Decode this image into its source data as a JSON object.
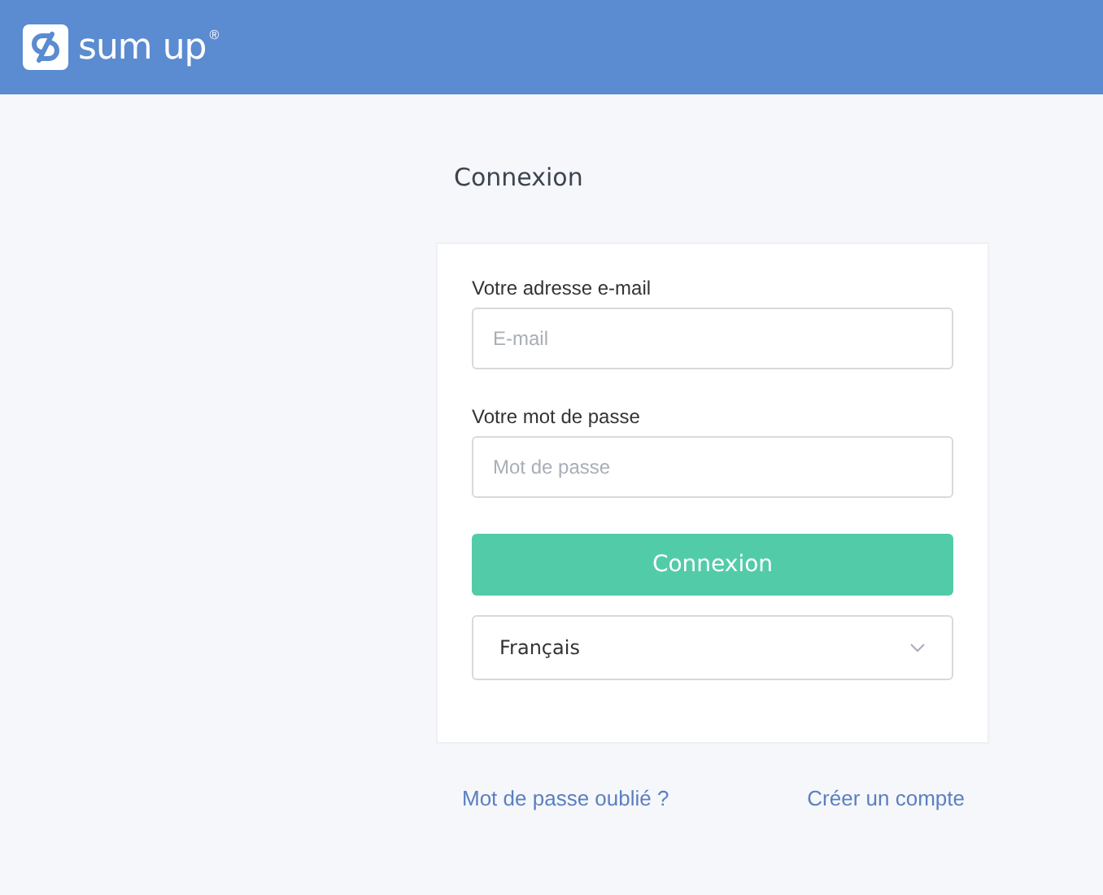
{
  "header": {
    "logo_text": "sum up",
    "logo_mark": "®"
  },
  "title": "Connexion",
  "form": {
    "fields": [
      {
        "label": "Votre adresse e-mail",
        "placeholder": "E-mail"
      },
      {
        "label": "Votre mot de passe",
        "placeholder": "Mot de passe"
      }
    ],
    "submit": "Connexion",
    "language": "Français"
  },
  "links": [
    "Mot de passe oublié ?",
    "Créer un compte"
  ]
}
